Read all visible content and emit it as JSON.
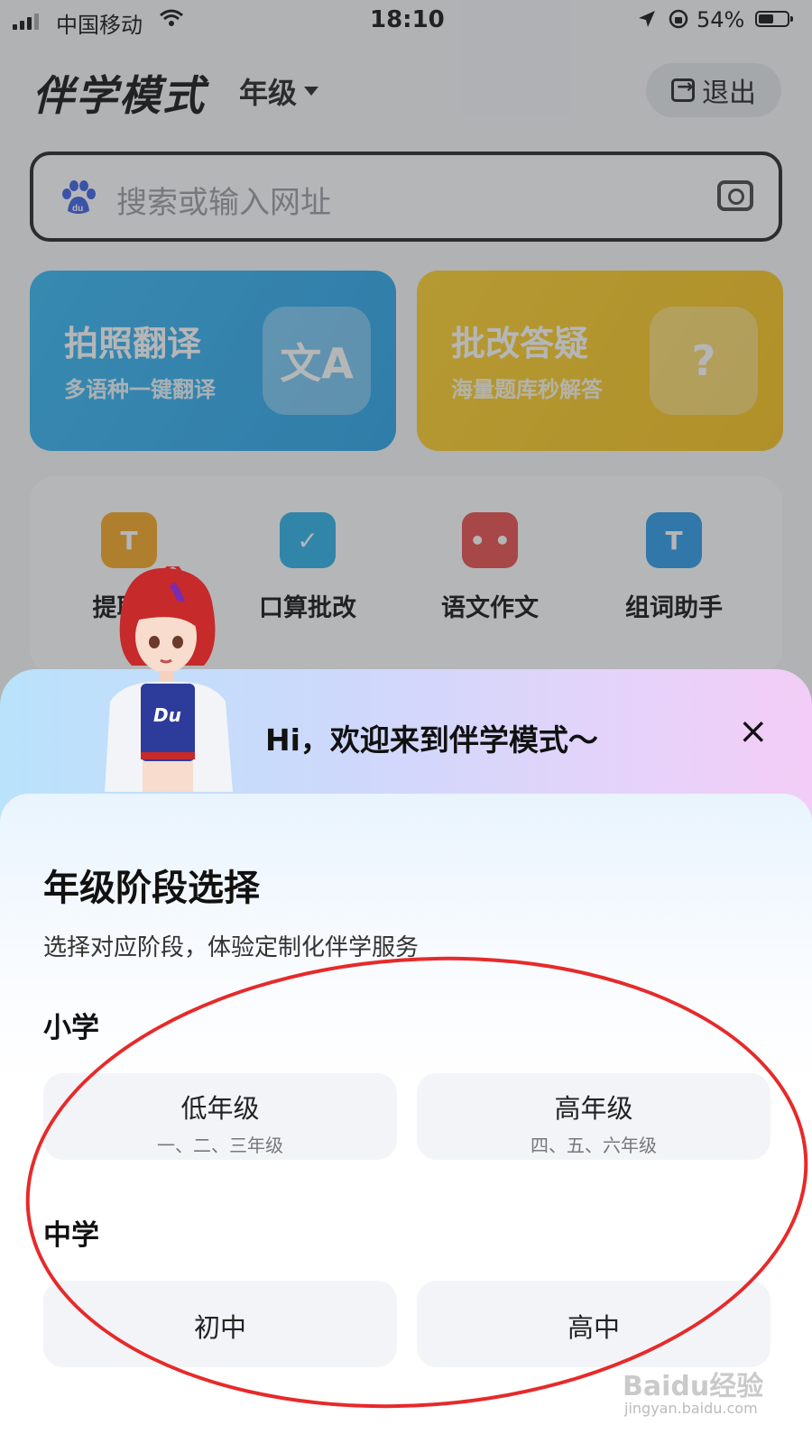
{
  "status_bar": {
    "carrier": "中国移动",
    "time": "18:10",
    "battery": "54%",
    "battery_level": 0.54
  },
  "header": {
    "title": "伴学模式",
    "grade_dropdown": "年级",
    "exit_label": "退出"
  },
  "search": {
    "placeholder": "搜索或输入网址",
    "logo": "du"
  },
  "cards": [
    {
      "title": "拍照翻译",
      "subtitle": "多语种一键翻译",
      "deco_icon": "translate-icon",
      "deco": "文A"
    },
    {
      "title": "批改答疑",
      "subtitle": "海量题库秒解答",
      "deco_icon": "question-icon",
      "deco": "?"
    }
  ],
  "tools": [
    {
      "label": "提取文",
      "icon": "text-extract-icon",
      "glyph": "T",
      "color": "#f5a623"
    },
    {
      "label": "口算批改",
      "icon": "check-icon",
      "glyph": "✓",
      "color": "#2bb0e8"
    },
    {
      "label": "语文作文",
      "icon": "book-icon",
      "glyph": "• •",
      "color": "#ea4c4c"
    },
    {
      "label": "组词助手",
      "icon": "word-icon",
      "glyph": "T",
      "color": "#2a9ae8"
    }
  ],
  "banner": {
    "greeting": "Hi，欢迎来到伴学模式～",
    "close": "×",
    "mascot_shirt": "Du"
  },
  "sheet": {
    "title": "年级阶段选择",
    "subtitle": "选择对应阶段，体验定制化伴学服务",
    "primary": {
      "label": "小学",
      "options": [
        {
          "name": "低年级",
          "detail": "一、二、三年级"
        },
        {
          "name": "高年级",
          "detail": "四、五、六年级"
        }
      ]
    },
    "middle": {
      "label": "中学",
      "options": [
        {
          "name": "初中"
        },
        {
          "name": "高中"
        }
      ]
    }
  },
  "watermark": {
    "brand": "Baidu经验",
    "url": "jingyan.baidu.com"
  },
  "colors": {
    "accent_blue": "#2aa3e8",
    "accent_yellow": "#f8c21a",
    "annotation_red": "#e62a2a"
  }
}
